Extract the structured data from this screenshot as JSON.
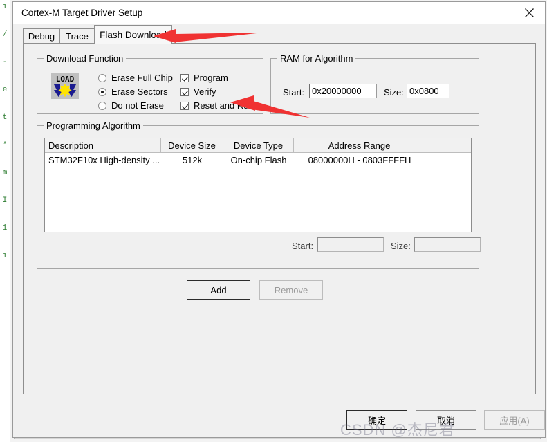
{
  "window": {
    "title": "Cortex-M Target Driver Setup",
    "close_icon": "close-icon"
  },
  "tabs": [
    {
      "label": "Debug",
      "active": false
    },
    {
      "label": "Trace",
      "active": false
    },
    {
      "label": "Flash Download",
      "active": true
    }
  ],
  "download_function": {
    "group_title": "Download Function",
    "icon": "load-icon",
    "icon_text": "LOAD",
    "erase_options": [
      {
        "label": "Erase Full Chip",
        "selected": false
      },
      {
        "label": "Erase Sectors",
        "selected": true
      },
      {
        "label": "Do not Erase",
        "selected": false
      }
    ],
    "checkboxes": [
      {
        "label": "Program",
        "checked": true
      },
      {
        "label": "Verify",
        "checked": true
      },
      {
        "label": "Reset and Run",
        "checked": true
      }
    ]
  },
  "ram_for_algorithm": {
    "group_title": "RAM for Algorithm",
    "start_label": "Start:",
    "start_value": "0x20000000",
    "size_label": "Size:",
    "size_value": "0x0800"
  },
  "programming_algorithm": {
    "group_title": "Programming Algorithm",
    "columns": [
      "Description",
      "Device Size",
      "Device Type",
      "Address Range",
      ""
    ],
    "rows": [
      {
        "description": "STM32F10x High-density ...",
        "device_size": "512k",
        "device_type": "On-chip Flash",
        "address_range": "08000000H - 0803FFFFH",
        "extra": ""
      }
    ],
    "start_label": "Start:",
    "start_value": "",
    "size_label": "Size:",
    "size_value": ""
  },
  "actions": {
    "add_label": "Add",
    "remove_label": "Remove",
    "remove_disabled": true
  },
  "footer": {
    "ok_label": "确定",
    "cancel_label": "取消",
    "apply_label": "应用(A)",
    "apply_disabled": true
  },
  "annotations": {
    "arrow_color": "#f03232",
    "arrow1_target": "Flash Download",
    "arrow2_target": "Reset and Run"
  },
  "watermark": {
    "text": "CSDN @杰尼君"
  },
  "editor_backdrop": {
    "gutter_chars": "i\n\n/\n\n-\n\ne\n\nt\n\n*\n\nm\n\nI\n\ni\n\ni"
  }
}
